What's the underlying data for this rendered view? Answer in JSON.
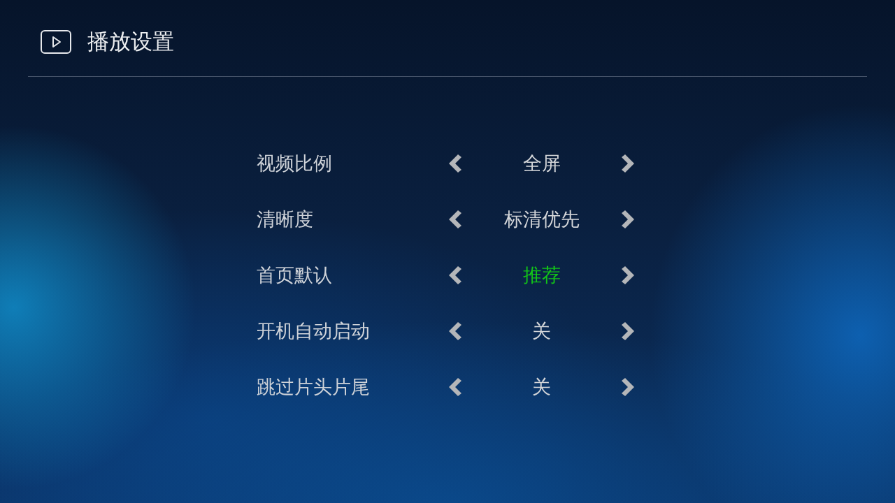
{
  "header": {
    "title": "播放设置"
  },
  "settings": [
    {
      "label": "视频比例",
      "value": "全屏",
      "selected": false
    },
    {
      "label": "清晰度",
      "value": "标清优先",
      "selected": false
    },
    {
      "label": "首页默认",
      "value": "推荐",
      "selected": true
    },
    {
      "label": "开机自动启动",
      "value": "关",
      "selected": false
    },
    {
      "label": "跳过片头片尾",
      "value": "关",
      "selected": false
    }
  ]
}
